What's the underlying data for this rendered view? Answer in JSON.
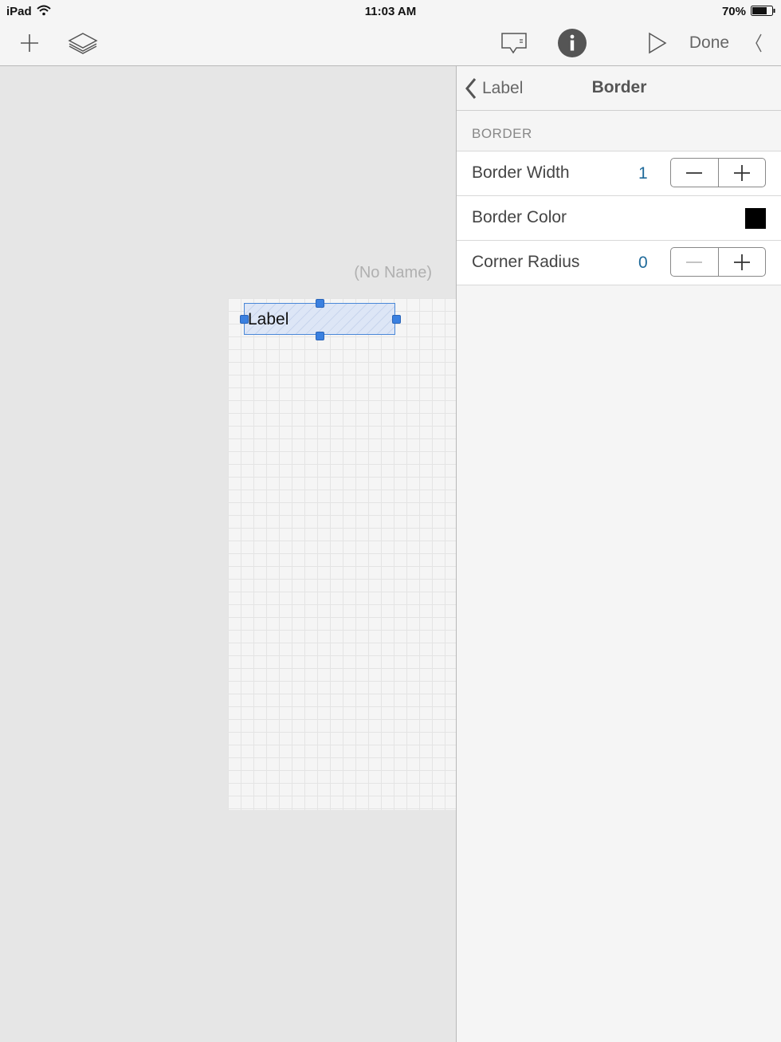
{
  "status_bar": {
    "carrier": "iPad",
    "time": "11:03 AM",
    "battery_percent": "70%"
  },
  "toolbar": {
    "left_icons": [
      "plus-icon",
      "layers-icon"
    ],
    "right_icons": [
      "comment-icon",
      "info-icon",
      "play-icon"
    ],
    "done_label": "Done"
  },
  "canvas": {
    "document_name": "(No Name)",
    "selected_element_text": "Label"
  },
  "inspector": {
    "back_label": "Label",
    "title": "Border",
    "section_header": "BORDER",
    "rows": [
      {
        "label": "Border Width",
        "value": "1",
        "control": "stepper"
      },
      {
        "label": "Border Color",
        "control": "color",
        "color": "#000000"
      },
      {
        "label": "Corner Radius",
        "value": "0",
        "control": "stepper"
      }
    ]
  }
}
